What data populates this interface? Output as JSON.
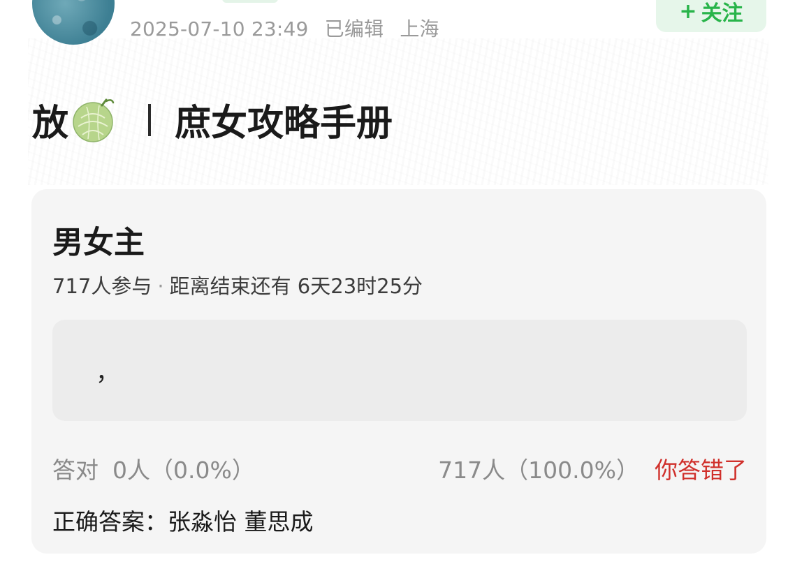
{
  "post": {
    "timestamp": "2025-07-10 23:49",
    "edited_label": "已编辑",
    "location": "上海",
    "follow_label": "关注",
    "follow_plus": "+",
    "title_prefix": "放",
    "title_emoji": "melon-icon",
    "title_text": "庶女攻略手册"
  },
  "quiz": {
    "title": "男女主",
    "participants": "717人参与",
    "separator": "·",
    "deadline": "距离结束还有 6天23时25分",
    "option_text": "，",
    "correct_label": "答对",
    "correct_stats": "0人（0.0%）",
    "wrong_stats": "717人（100.0%）",
    "result_message": "你答错了",
    "answer_label": "正确答案：",
    "answer_value": "张淼怡 董思成"
  },
  "colors": {
    "follow_bg": "#e6f6ea",
    "follow_text": "#28b44a",
    "wrong_text": "#d0302b",
    "card_bg": "#f5f5f5",
    "meta_text": "#9a9a9a"
  }
}
